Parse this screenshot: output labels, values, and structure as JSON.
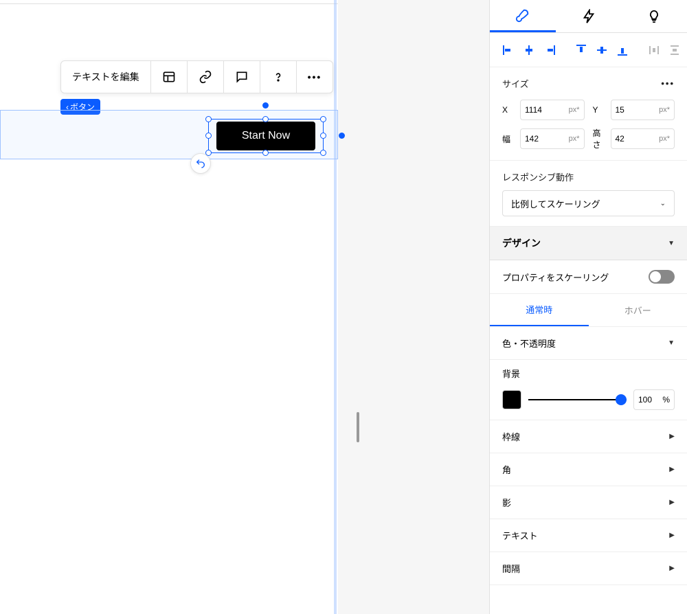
{
  "toolbar": {
    "edit_text": "テキストを編集"
  },
  "breadcrumb": {
    "label": "ボタン"
  },
  "element": {
    "label": "Start Now"
  },
  "panel": {
    "size": {
      "title": "サイズ",
      "x_label": "X",
      "x_value": "1114",
      "x_unit": "px*",
      "y_label": "Y",
      "y_value": "15",
      "y_unit": "px*",
      "w_label": "幅",
      "w_value": "142",
      "w_unit": "px*",
      "h_label": "高さ",
      "h_value": "42",
      "h_unit": "px*"
    },
    "responsive": {
      "title": "レスポンシブ動作",
      "value": "比例してスケーリング"
    },
    "design": {
      "title": "デザイン"
    },
    "scale_props": "プロパティをスケーリング",
    "states": {
      "normal": "通常時",
      "hover": "ホバー"
    },
    "color_opacity": "色・不透明度",
    "background": {
      "label": "背景",
      "pct": "100",
      "pct_unit": "%"
    },
    "border": "枠線",
    "corner": "角",
    "shadow": "影",
    "text": "テキスト",
    "spacing": "間隔"
  }
}
